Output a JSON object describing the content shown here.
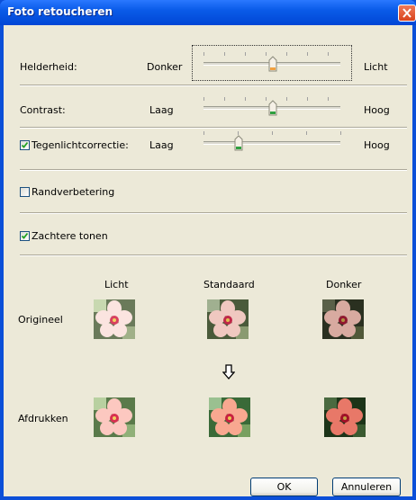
{
  "window": {
    "title": "Foto retoucheren"
  },
  "sliders": [
    {
      "label": "Helderheid:",
      "min_label": "Donker",
      "max_label": "Licht",
      "value_fraction": 0.5
    },
    {
      "label": "Contrast:",
      "min_label": "Laag",
      "max_label": "Hoog",
      "value_fraction": 0.5
    },
    {
      "label": "Tegenlichtcorrectie:",
      "min_label": "Laag",
      "max_label": "Hoog",
      "value_fraction": 0.25,
      "checked": true
    }
  ],
  "options": {
    "edge": {
      "label": "Randverbetering",
      "checked": false
    },
    "soft": {
      "label": "Zachtere tonen",
      "checked": true
    }
  },
  "preview": {
    "columns": [
      "Licht",
      "Standaard",
      "Donker"
    ],
    "row_original": "Origineel",
    "row_print": "Afdrukken",
    "arrow_icon": "arrow-down-icon"
  },
  "buttons": {
    "ok": "OK",
    "cancel": "Annuleren"
  },
  "colors": {
    "titlebar": "#0a5be8",
    "dialog_bg": "#ece9d8",
    "close": "#d9431c"
  }
}
